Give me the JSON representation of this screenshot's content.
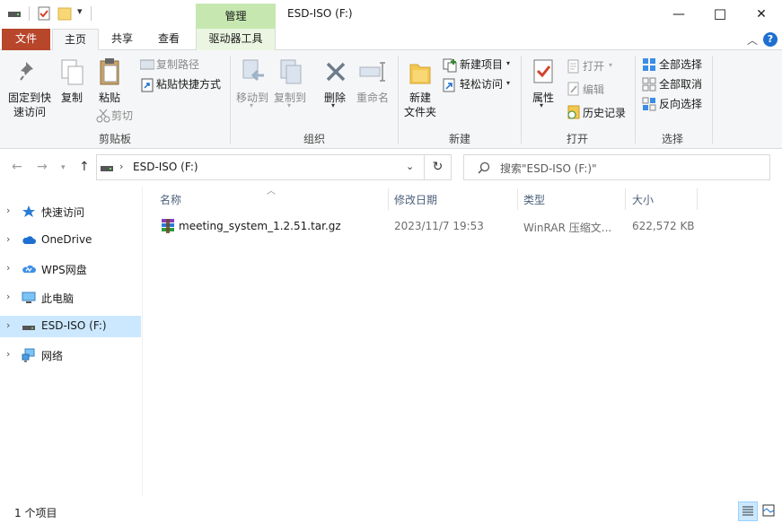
{
  "window": {
    "title": "ESD-ISO (F:)",
    "context_tab_group": "管理",
    "controls": {
      "minimize": "—",
      "maximize": "☐",
      "close": "✕"
    }
  },
  "tabs": [
    {
      "label": "文件",
      "state": "file"
    },
    {
      "label": "主页",
      "state": "active"
    },
    {
      "label": "共享",
      "state": "normal"
    },
    {
      "label": "查看",
      "state": "normal"
    },
    {
      "label": "驱动器工具",
      "state": "context"
    }
  ],
  "ribbon": {
    "clipboard": {
      "group_label": "剪贴板",
      "pin_quick_access": "固定到快\n速访问",
      "copy": "复制",
      "paste": "粘贴",
      "copy_path": "复制路径",
      "paste_shortcut": "粘贴快捷方式",
      "cut": "剪切"
    },
    "organize": {
      "group_label": "组织",
      "move_to": "移动到",
      "copy_to": "复制到",
      "delete": "删除",
      "rename": "重命名"
    },
    "new": {
      "group_label": "新建",
      "new_folder": "新建\n文件夹",
      "new_item": "新建项目",
      "easy_access": "轻松访问"
    },
    "open": {
      "group_label": "打开",
      "properties": "属性",
      "open": "打开",
      "edit": "编辑",
      "history": "历史记录"
    },
    "select": {
      "group_label": "选择",
      "select_all": "全部选择",
      "select_none": "全部取消",
      "invert": "反向选择"
    }
  },
  "address": {
    "path": "ESD-ISO (F:)",
    "search_placeholder": "搜索\"ESD-ISO (F:)\""
  },
  "nav": [
    {
      "label": "快速访问",
      "icon": "star-icon",
      "selected": false
    },
    {
      "label": "OneDrive",
      "icon": "cloud-icon",
      "selected": false
    },
    {
      "label": "WPS网盘",
      "icon": "wps-cloud-icon",
      "selected": false
    },
    {
      "label": "此电脑",
      "icon": "computer-icon",
      "selected": false
    },
    {
      "label": "ESD-ISO (F:)",
      "icon": "drive-icon",
      "selected": true
    },
    {
      "label": "网络",
      "icon": "network-icon",
      "selected": false
    }
  ],
  "columns": {
    "name": "名称",
    "modified": "修改日期",
    "type": "类型",
    "size": "大小"
  },
  "files": [
    {
      "name": "meeting_system_1.2.51.tar.gz",
      "modified": "2023/11/7 19:53",
      "type": "WinRAR 压缩文...",
      "size": "622,572 KB",
      "icon": "winrar-archive-icon"
    }
  ],
  "status": {
    "item_count": "1 个项目"
  },
  "colors": {
    "accent": "#1e6fd1",
    "file_tab": "#b8462b",
    "context_band": "#c6e8b0",
    "selection": "#cce8ff"
  }
}
